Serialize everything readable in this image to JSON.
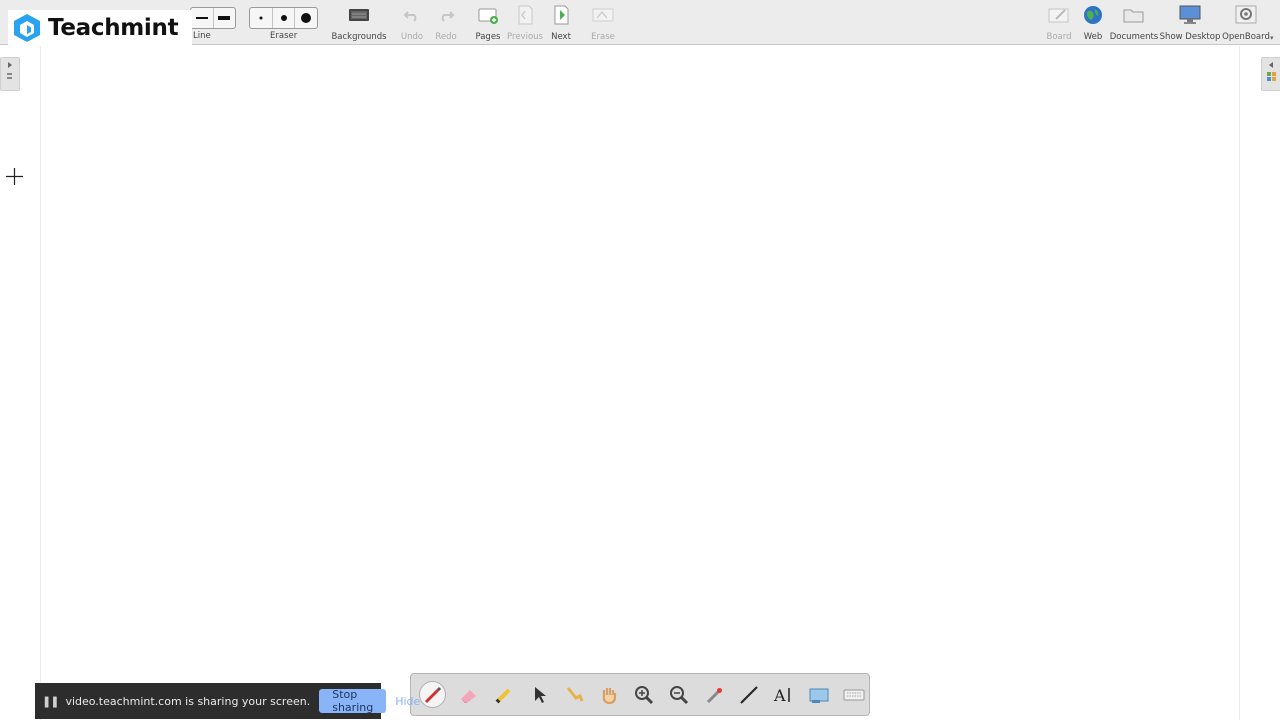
{
  "logo": {
    "text": "Teachmint"
  },
  "toolbar": {
    "line_label": "Line",
    "eraser_label": "Eraser",
    "backgrounds_label": "Backgrounds",
    "undo_label": "Undo",
    "redo_label": "Redo",
    "pages_label": "Pages",
    "previous_label": "Previous",
    "next_label": "Next",
    "erase_label": "Erase",
    "board_label": "Board",
    "web_label": "Web",
    "documents_label": "Documents",
    "show_desktop_label": "Show Desktop",
    "openboard_label": "OpenBoard"
  },
  "share_bar": {
    "message": "video.teachmint.com is sharing your screen.",
    "stop_label": "Stop sharing",
    "hide_label": "Hide"
  },
  "palette": {
    "tools": [
      "pen-icon",
      "eraser-icon",
      "marker-icon",
      "selector-icon",
      "interactor-icon",
      "hand-icon",
      "zoom-in-icon",
      "zoom-out-icon",
      "laser-pointer-icon",
      "line-icon",
      "text-icon",
      "capture-icon",
      "keyboard-icon"
    ]
  },
  "colors": {
    "toolbar": "#ececec",
    "share_button": "#8ab4f8",
    "next_green": "#4caf50",
    "logo_blue": "#29a3ef"
  }
}
